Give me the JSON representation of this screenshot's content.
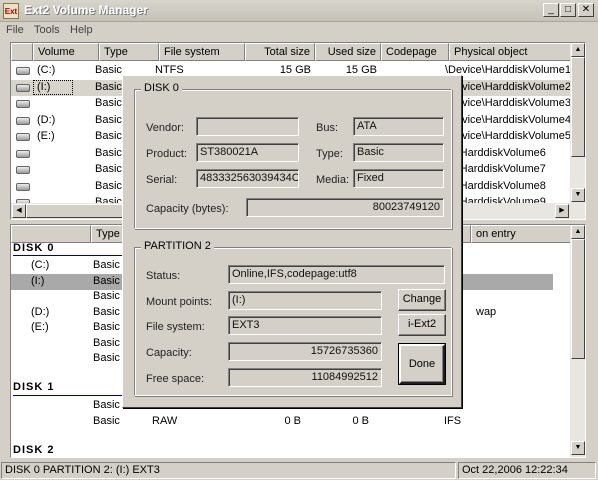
{
  "window": {
    "title": "Ext2 Volume Manager",
    "icon_text": "Ext",
    "minimize": "_",
    "maximize": "□",
    "close": "✕"
  },
  "menu": [
    "File",
    "Tools",
    "Help"
  ],
  "volume_table": {
    "columns": [
      "Volume",
      "Type",
      "File system",
      "Total size",
      "Used size",
      "Codepage",
      "Physical object"
    ],
    "rows": [
      {
        "volume": "(C:)",
        "type": "Basic",
        "fs": "NTFS",
        "total": "15 GB",
        "used": "15 GB",
        "codepage": "",
        "physical": "\\Device\\HarddiskVolume1"
      },
      {
        "volume": "(I:)",
        "type": "Basic",
        "fs": "",
        "total": "",
        "used": "",
        "codepage": "",
        "physical": "\\Device\\HarddiskVolume2"
      },
      {
        "volume": "",
        "type": "Basic",
        "fs": "",
        "total": "",
        "used": "",
        "codepage": "",
        "physical": "\\Device\\HarddiskVolume3"
      },
      {
        "volume": "(D:)",
        "type": "Basic",
        "fs": "",
        "total": "",
        "used": "",
        "codepage": "",
        "physical": "\\Device\\HarddiskVolume4"
      },
      {
        "volume": "(E:)",
        "type": "Basic",
        "fs": "",
        "total": "",
        "used": "",
        "codepage": "",
        "physical": "\\Device\\HarddiskVolume5"
      },
      {
        "volume": "",
        "type": "Basic",
        "fs": "",
        "total": "",
        "used": "",
        "codepage": "",
        "physical": "ce\\HarddiskVolume6"
      },
      {
        "volume": "",
        "type": "Basic",
        "fs": "",
        "total": "",
        "used": "",
        "codepage": "",
        "physical": "ce\\HarddiskVolume7"
      },
      {
        "volume": "",
        "type": "Basic",
        "fs": "",
        "total": "",
        "used": "",
        "codepage": "",
        "physical": "ce\\HarddiskVolume8"
      },
      {
        "volume": "",
        "type": "Basic",
        "fs": "",
        "total": "",
        "used": "",
        "codepage": "",
        "physical": "ce\\HarddiskVolume9"
      }
    ],
    "selected_index": 1
  },
  "disk_list": {
    "columns": [
      "",
      "Type",
      "",
      "",
      "",
      "on entry"
    ],
    "disk0": {
      "title": "DISK 0",
      "rows": [
        {
          "volume": "(C:)",
          "type": "Basic",
          "extra": ""
        },
        {
          "volume": "(I:)",
          "type": "Basic",
          "extra": ""
        },
        {
          "volume": "",
          "type": "Basic",
          "extra": ""
        },
        {
          "volume": "(D:)",
          "type": "Basic",
          "extra": "wap"
        },
        {
          "volume": "(E:)",
          "type": "Basic",
          "extra": ""
        },
        {
          "volume": "",
          "type": "Basic",
          "extra": ""
        },
        {
          "volume": "",
          "type": "Basic",
          "extra": ""
        }
      ]
    },
    "disk1": {
      "title": "DISK 1",
      "rows": [
        {
          "type": "Basic",
          "fs": "",
          "total": "",
          "used": "",
          "entry": ""
        },
        {
          "type": "Basic",
          "fs": "RAW",
          "total": "0 B",
          "used": "0 B",
          "entry": "IFS"
        }
      ]
    },
    "disk2": {
      "title": "DISK 2"
    }
  },
  "status_bar": {
    "left": "DISK 0 PARTITION 2: (I:) EXT3",
    "right": "Oct 22,2006 12:22:34"
  },
  "dialog": {
    "disk_group": {
      "title": "DISK 0",
      "vendor_label": "Vendor:",
      "vendor": "",
      "bus_label": "Bus:",
      "bus": "ATA",
      "product_label": "Product:",
      "product": "ST380021A",
      "type_label": "Type:",
      "type": "Basic",
      "serial_label": "Serial:",
      "serial": "483332563039434C",
      "media_label": "Media:",
      "media": "Fixed",
      "capacity_label": "Capacity (bytes):",
      "capacity": "80023749120"
    },
    "partition_group": {
      "title": "PARTITION 2",
      "status_label": "Status:",
      "status": "Online,IFS,codepage:utf8",
      "mount_label": "Mount points:",
      "mount": "(I:)",
      "fs_label": "File system:",
      "fs": "EXT3",
      "capacity_label": "Capacity:",
      "capacity": "15726735360",
      "free_label": "Free space:",
      "free": "11084992512"
    },
    "buttons": {
      "change": "Change",
      "iext2": "i-Ext2",
      "done": "Done"
    }
  }
}
